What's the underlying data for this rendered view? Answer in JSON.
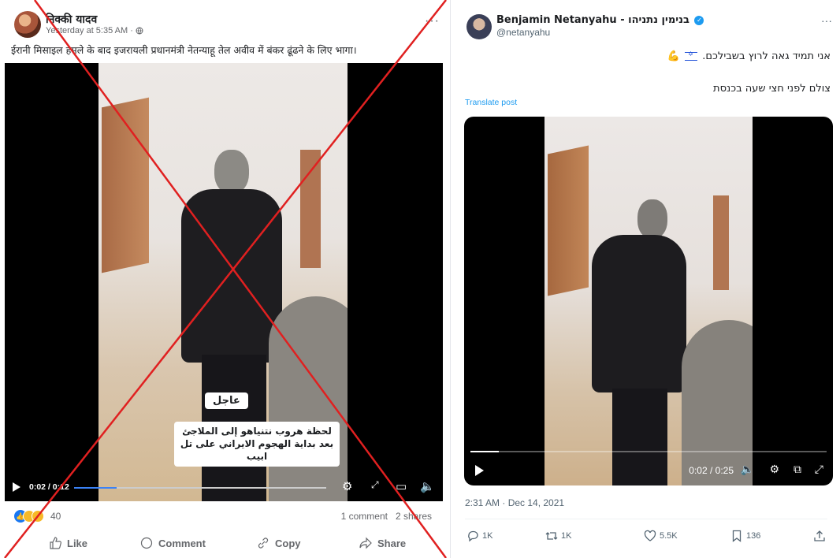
{
  "facebook_post": {
    "author": "निक्की यादव",
    "timestamp": "Yesterday at 5:35 AM · ",
    "body": "ईरानी मिसाइल हमले के बाद इजरायली प्रधानमंत्री नेतन्याहू तेल अवीव में बंकर ढूंढने के लिए भागा।",
    "more_label": "···",
    "video": {
      "badge": "عاجل",
      "caption": "لحظة هروب نتنياهو إلى الملاجئ بعد بداية الهجوم الايراني على تل ابيب",
      "time": "0:02 / 0:12",
      "progress": 0.17
    },
    "reactions": {
      "count": "40",
      "comments": "1 comment",
      "shares": "2 shares"
    },
    "actions": {
      "like": "Like",
      "comment": "Comment",
      "copy": "Copy",
      "share": "Share"
    },
    "overlay_mark": "red-x-cross",
    "overlay_color": "#e02020"
  },
  "x_post": {
    "display_name": "Benjamin Netanyahu - בנימין נתניהו",
    "handle": "@netanyahu",
    "more_label": "···",
    "text_line1_before": "אני תמיד גאה לרוץ בשבילכם.",
    "text_line2": "צולם לפני חצי שעה בכנסת",
    "translate_label": "Translate post",
    "video": {
      "time": "0:02 / 0:25",
      "progress": 0.08
    },
    "date": "2:31 AM · Dec 14, 2021",
    "stats": {
      "replies": "1K",
      "reposts": "1K",
      "likes": "5.5K",
      "bookmarks": "136"
    },
    "accent_color": "#1d9bf0"
  }
}
